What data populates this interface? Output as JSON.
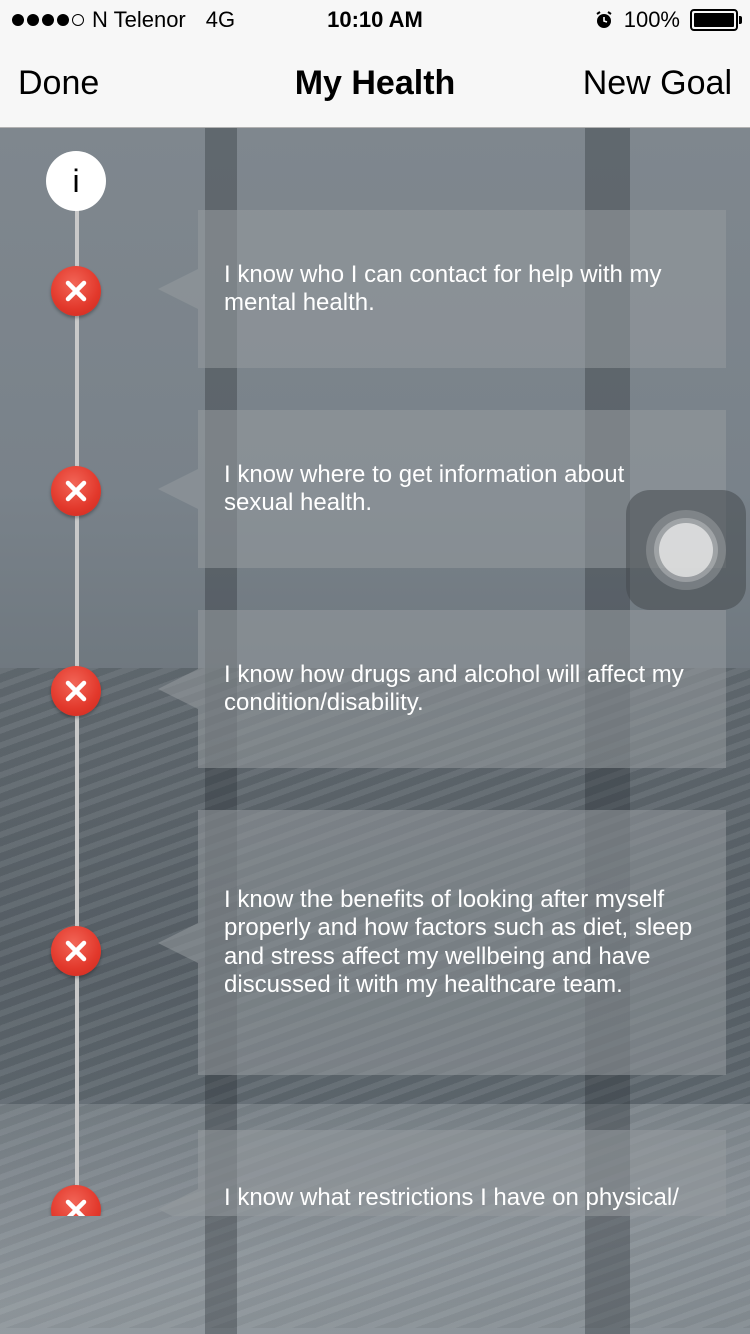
{
  "status_bar": {
    "carrier": "N Telenor",
    "network": "4G",
    "time": "10:10 AM",
    "battery": "100%",
    "signal_bars_filled": 4,
    "signal_bars_total": 5,
    "icons": [
      "signal-dots-icon",
      "alarm-icon",
      "battery-icon"
    ]
  },
  "nav": {
    "left_label": "Done",
    "title": "My Health",
    "right_label": "New Goal"
  },
  "timeline": {
    "info_label": "i",
    "colors": {
      "line": "#c9c9c9",
      "mark": "#e2382b",
      "card": "#969a9e"
    },
    "goals": [
      {
        "text": "I know who I can contact for help with my mental health.",
        "status": "not-achieved",
        "icon": "close-icon"
      },
      {
        "text": "I know where to get information about sexual health.",
        "status": "not-achieved",
        "icon": "close-icon"
      },
      {
        "text": "I know how drugs and alcohol will affect my condition/disability.",
        "status": "not-achieved",
        "icon": "close-icon"
      },
      {
        "text": "I know the benefits of looking after myself properly and how factors such as diet, sleep and stress affect my wellbeing and have discussed it with my healthcare team.",
        "status": "not-achieved",
        "icon": "close-icon"
      },
      {
        "text": "I know what restrictions I have on physical/",
        "status": "not-achieved",
        "icon": "close-icon"
      }
    ]
  },
  "overlay": {
    "icon": "assistive-touch-icon"
  }
}
